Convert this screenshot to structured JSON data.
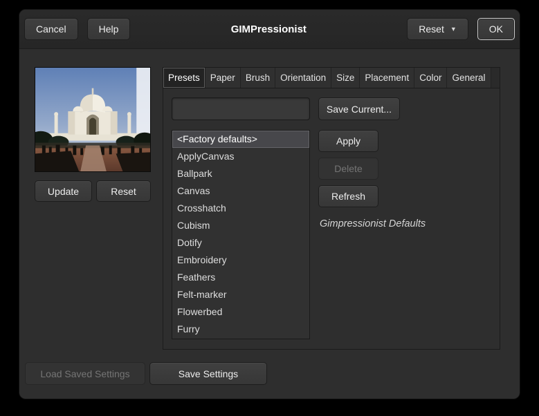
{
  "window": {
    "title": "GIMPressionist"
  },
  "header": {
    "cancel_label": "Cancel",
    "help_label": "Help",
    "reset_label": "Reset",
    "ok_label": "OK"
  },
  "icons": {
    "chevron_down": "▼"
  },
  "preview": {
    "update_label": "Update",
    "reset_label": "Reset"
  },
  "tabs": {
    "active": "Presets",
    "items": [
      "Presets",
      "Paper",
      "Brush",
      "Orientation",
      "Size",
      "Placement",
      "Color",
      "General"
    ]
  },
  "presets": {
    "entry_value": "",
    "save_current_label": "Save Current...",
    "apply_label": "Apply",
    "delete_label": "Delete",
    "refresh_label": "Refresh",
    "description": "Gimpressionist Defaults",
    "selected_item": "<Factory defaults>",
    "list": [
      "<Factory defaults>",
      "ApplyCanvas",
      "Ballpark",
      "Canvas",
      "Crosshatch",
      "Cubism",
      "Dotify",
      "Embroidery",
      "Feathers",
      "Felt-marker",
      "Flowerbed",
      "Furry"
    ]
  },
  "footer": {
    "load_saved_label": "Load Saved Settings",
    "save_settings_label": "Save Settings"
  },
  "colors": {
    "dialog_bg": "#2e2e2e",
    "selection": "#47474b"
  }
}
